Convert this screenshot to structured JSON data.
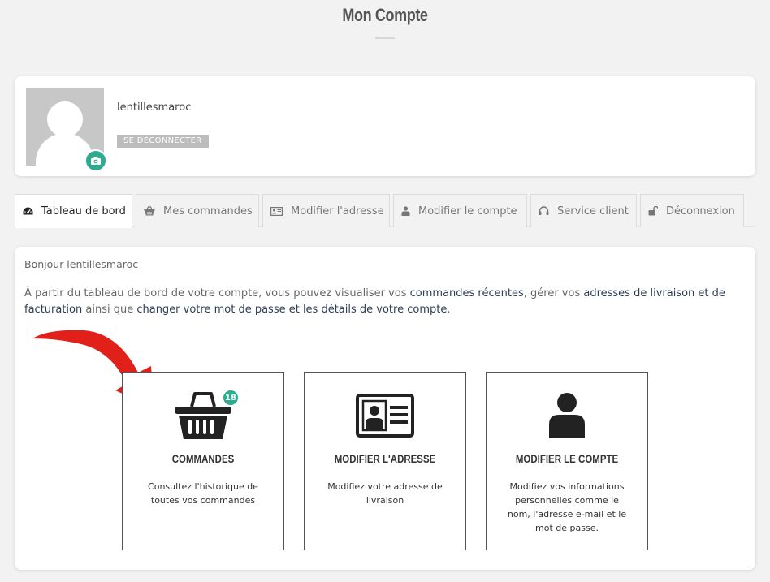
{
  "page": {
    "title": "Mon Compte"
  },
  "profile": {
    "username": "lentillesmaroc",
    "logout_label": "SE DÉCONNECTER",
    "camera_icon": "camera-icon"
  },
  "tabs": [
    {
      "label": "Tableau de bord",
      "icon": "dashboard-icon",
      "active": true
    },
    {
      "label": "Mes commandes",
      "icon": "basket-icon",
      "active": false
    },
    {
      "label": "Modifier l'adresse",
      "icon": "address-card-icon",
      "active": false
    },
    {
      "label": "Modifier le compte",
      "icon": "user-icon",
      "active": false
    },
    {
      "label": "Service client",
      "icon": "headset-icon",
      "active": false
    },
    {
      "label": "Déconnexion",
      "icon": "unlock-icon",
      "active": false
    }
  ],
  "dashboard": {
    "greeting": "Bonjour lentillesmaroc",
    "intro": {
      "t1": "À partir du tableau de bord de votre compte, vous pouvez visualiser vos ",
      "link1": "commandes récentes",
      "t2": ", gérer vos ",
      "link2": "adresses de livraison et de facturation",
      "t3": " ainsi que ",
      "link3": "changer votre mot de passe et les détails de votre compte",
      "t4": "."
    },
    "boxes": [
      {
        "title": "COMMANDES",
        "desc": "Consultez l'historique de toutes vos commandes",
        "badge": "18",
        "icon": "basket-icon"
      },
      {
        "title": "MODIFIER L'ADRESSE",
        "desc": "Modifiez votre adresse de livraison",
        "icon": "address-card-icon"
      },
      {
        "title": "MODIFIER LE COMPTE",
        "desc": "Modifiez vos informations personnelles comme le nom, l'adresse e-mail et le mot de passe.",
        "icon": "user-icon"
      }
    ]
  },
  "colors": {
    "accent": "#2eaa8f",
    "link": "#2c3e55",
    "arrow": "#e1201a",
    "background": "#f2f2f2"
  }
}
